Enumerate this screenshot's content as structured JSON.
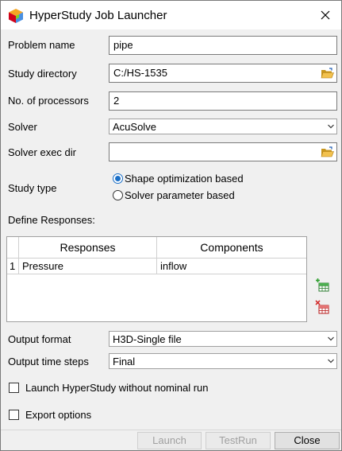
{
  "window": {
    "title": "HyperStudy Job Launcher"
  },
  "fields": {
    "problem_name": {
      "label": "Problem name",
      "value": "pipe"
    },
    "study_directory": {
      "label": "Study directory",
      "value": "C:/HS-1535"
    },
    "num_processors": {
      "label": "No. of processors",
      "value": "2"
    },
    "solver": {
      "label": "Solver",
      "value": "AcuSolve"
    },
    "solver_exec_dir": {
      "label": "Solver exec dir",
      "value": ""
    }
  },
  "study_type": {
    "label": "Study type",
    "options": [
      "Shape optimization based",
      "Solver parameter based"
    ],
    "selected": "Shape optimization based"
  },
  "responses": {
    "label": "Define Responses:",
    "columns": [
      "Responses",
      "Components"
    ],
    "rows": [
      {
        "index": "1",
        "response": "Pressure",
        "component": "inflow"
      }
    ]
  },
  "output": {
    "format_label": "Output format",
    "format_value": "H3D-Single file",
    "time_steps_label": "Output time steps",
    "time_steps_value": "Final"
  },
  "checkboxes": {
    "launch_without_nominal": {
      "label": "Launch HyperStudy without nominal run",
      "checked": false
    },
    "export_options": {
      "label": "Export options",
      "checked": false
    }
  },
  "buttons": {
    "launch": "Launch",
    "test_run": "TestRun",
    "close": "Close"
  },
  "icons": {
    "app": "hyperstudy-cube-icon",
    "browse": "folder-open-icon",
    "add_row": "add-row-icon",
    "delete_row": "delete-row-icon"
  },
  "colors": {
    "accent": "#1a6fc7",
    "disabled_text": "#a0a0a0"
  }
}
